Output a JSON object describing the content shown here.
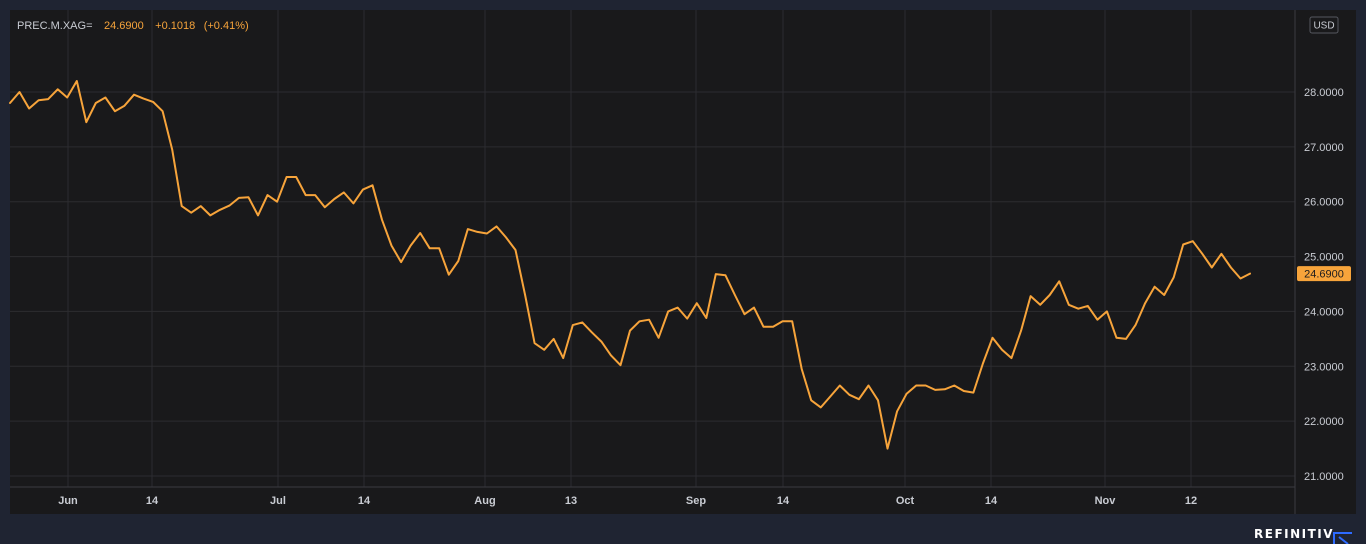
{
  "legend": {
    "symbol": "PREC.M.XAG=",
    "last": "24.6900",
    "change": "+0.1018",
    "change_pct": "(+0.41%)"
  },
  "currency": "USD",
  "brand": "REFINITIV",
  "colors": {
    "background": "#1f2432",
    "plot": "#19191b",
    "line": "#f7a43b",
    "grid": "#2c2c30",
    "text": "#c9ccd3"
  },
  "chart_data": {
    "type": "line",
    "title": "",
    "xlabel": "",
    "ylabel": "",
    "ylim": [
      21.0,
      28.0
    ],
    "y_ticks": [
      "28.0000",
      "27.0000",
      "26.0000",
      "25.0000",
      "24.0000",
      "23.0000",
      "22.0000",
      "21.0000"
    ],
    "x_tick_labels": [
      "Jun",
      "14",
      "Jul",
      "14",
      "Aug",
      "13",
      "Sep",
      "14",
      "Oct",
      "14",
      "Nov",
      "12"
    ],
    "last_value_label": "24.6900",
    "grid": true,
    "series": [
      {
        "values": [
          27.8,
          28.0,
          27.7,
          27.85,
          27.87,
          28.05,
          27.9,
          28.2,
          27.45,
          27.8,
          27.9,
          27.65,
          27.75,
          27.95,
          27.88,
          27.82,
          27.65,
          26.95,
          25.92,
          25.8,
          25.92,
          25.75,
          25.85,
          25.93,
          26.07,
          26.08,
          25.75,
          26.12,
          26.0,
          26.45,
          26.45,
          26.12,
          26.12,
          25.9,
          26.05,
          26.17,
          25.97,
          26.22,
          26.3,
          25.67,
          25.2,
          24.9,
          25.2,
          25.43,
          25.15,
          25.15,
          24.67,
          24.92,
          25.5,
          25.45,
          25.42,
          25.55,
          25.35,
          25.12,
          24.3,
          23.42,
          23.3,
          23.5,
          23.15,
          23.75,
          23.8,
          23.62,
          23.45,
          23.2,
          23.02,
          23.65,
          23.82,
          23.85,
          23.52,
          24.0,
          24.07,
          23.87,
          24.15,
          23.88,
          24.68,
          24.66,
          24.3,
          23.95,
          24.07,
          23.72,
          23.72,
          23.82,
          23.82,
          22.95,
          22.38,
          22.25,
          22.45,
          22.65,
          22.48,
          22.4,
          22.65,
          22.38,
          21.5,
          22.18,
          22.5,
          22.65,
          22.65,
          22.57,
          22.58,
          22.65,
          22.55,
          22.52,
          23.05,
          23.52,
          23.3,
          23.15,
          23.65,
          24.28,
          24.12,
          24.3,
          24.55,
          24.12,
          24.05,
          24.1,
          23.85,
          24.0,
          23.52,
          23.5,
          23.75,
          24.15,
          24.45,
          24.3,
          24.62,
          25.22,
          25.28,
          25.05,
          24.8,
          25.05,
          24.8,
          24.6,
          24.69
        ]
      }
    ]
  }
}
